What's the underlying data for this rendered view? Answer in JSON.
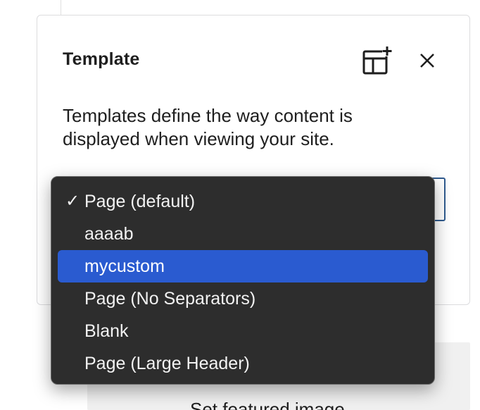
{
  "panel": {
    "title": "Template",
    "description": "Templates define the way content is displayed when viewing your site.",
    "add_template_icon": "add-template-icon",
    "close_icon": "close-icon"
  },
  "template_select": {
    "selected": "Page (default)",
    "checkmark": "✓",
    "highlighted": "mycustom",
    "options": [
      {
        "label": "Page (default)"
      },
      {
        "label": "aaaab"
      },
      {
        "label": "mycustom"
      },
      {
        "label": "Page (No Separators)"
      },
      {
        "label": "Blank"
      },
      {
        "label": "Page (Large Header)"
      }
    ]
  },
  "featured_image": {
    "label": "Set featured image"
  },
  "colors": {
    "menu_bg": "#2d2d2d",
    "highlight": "#2a5bd0",
    "select_border": "#2f5b8f"
  }
}
